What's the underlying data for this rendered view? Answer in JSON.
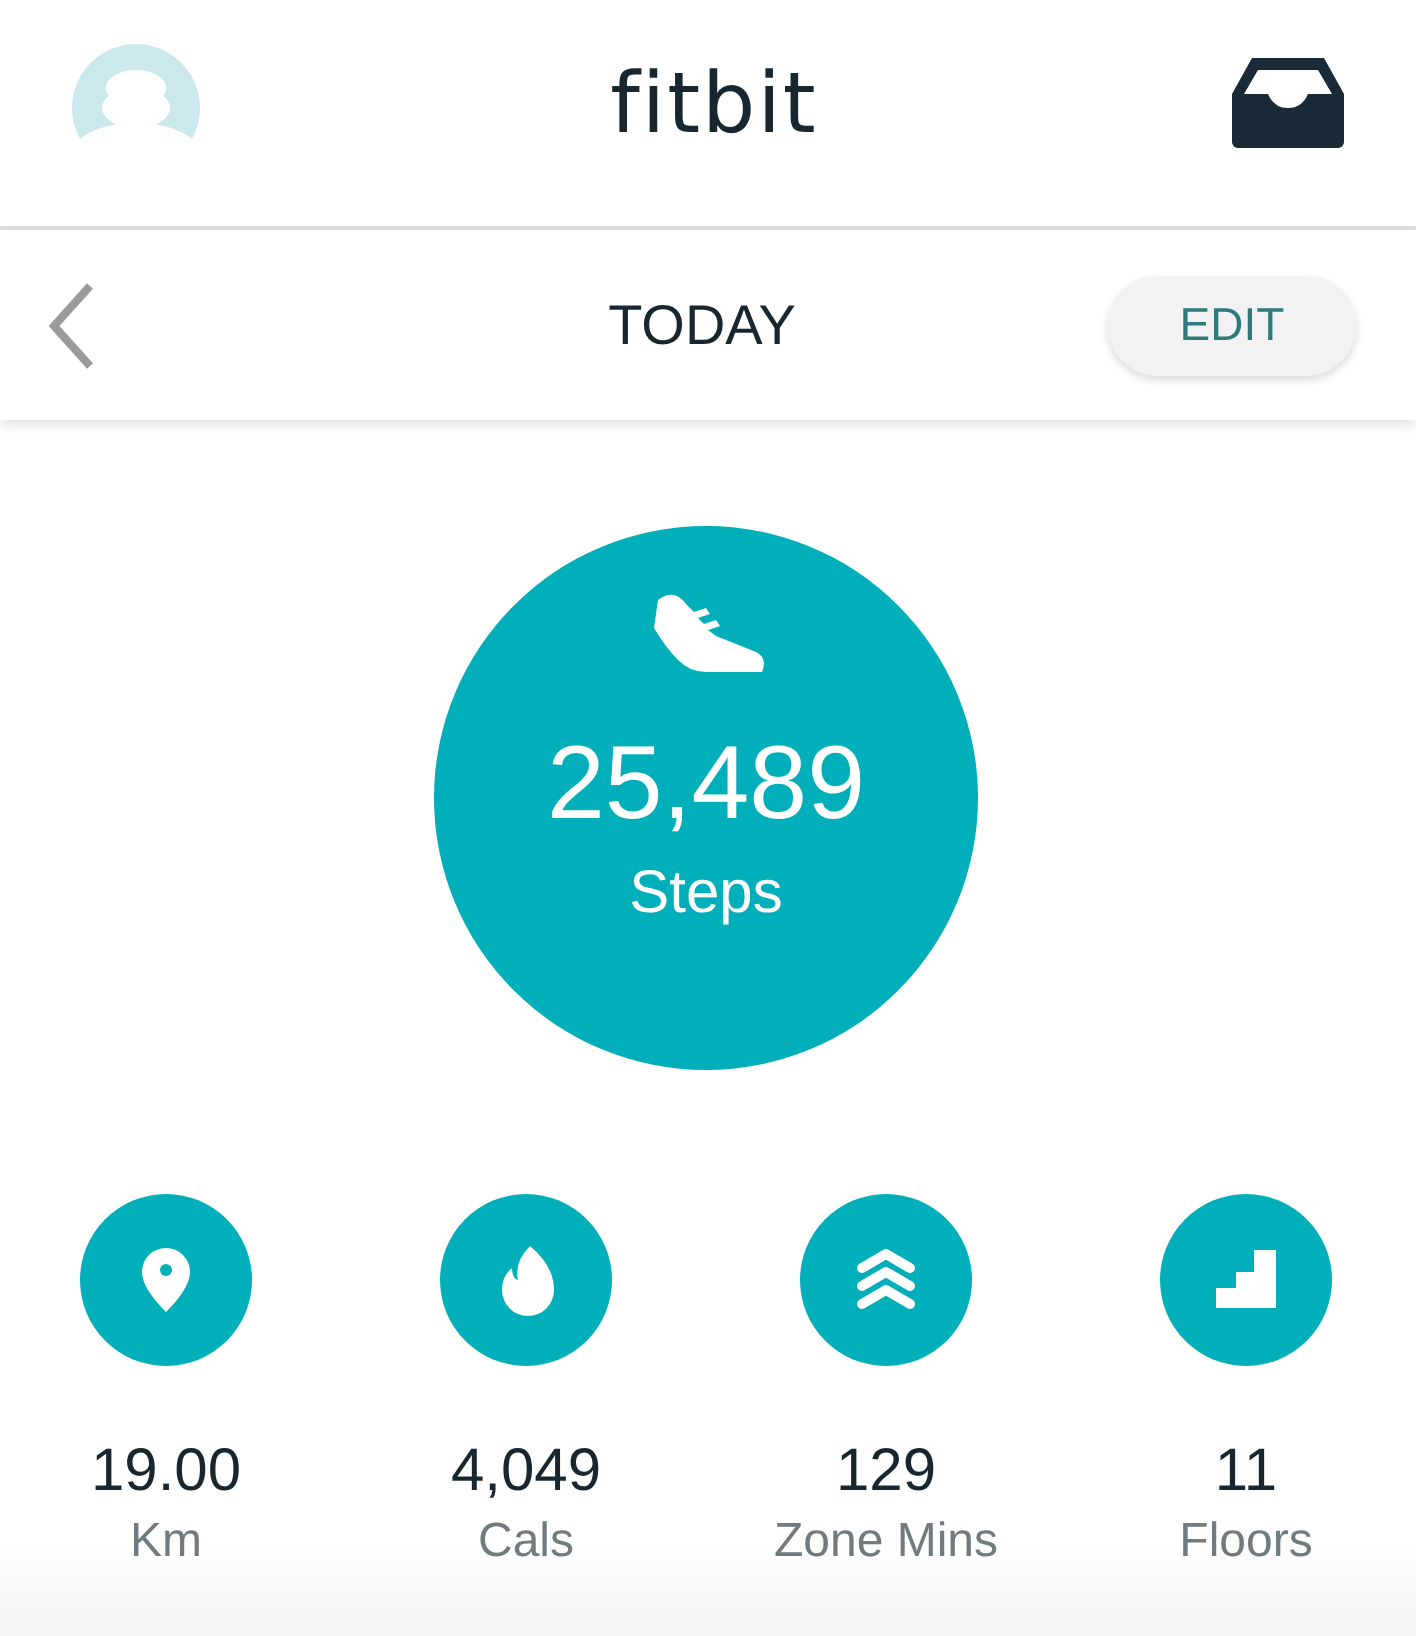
{
  "header": {
    "title": "fitbit"
  },
  "toolbar": {
    "title": "TODAY",
    "edit_button": "EDIT"
  },
  "steps": {
    "value": "25,489",
    "label": "Steps"
  },
  "stats": [
    {
      "kind": "distance",
      "value": "19.00",
      "label": "Km"
    },
    {
      "kind": "calories",
      "value": "4,049",
      "label": "Cals"
    },
    {
      "kind": "zone",
      "value": "129",
      "label": "Zone Mins"
    },
    {
      "kind": "floors",
      "value": "11",
      "label": "Floors"
    }
  ]
}
